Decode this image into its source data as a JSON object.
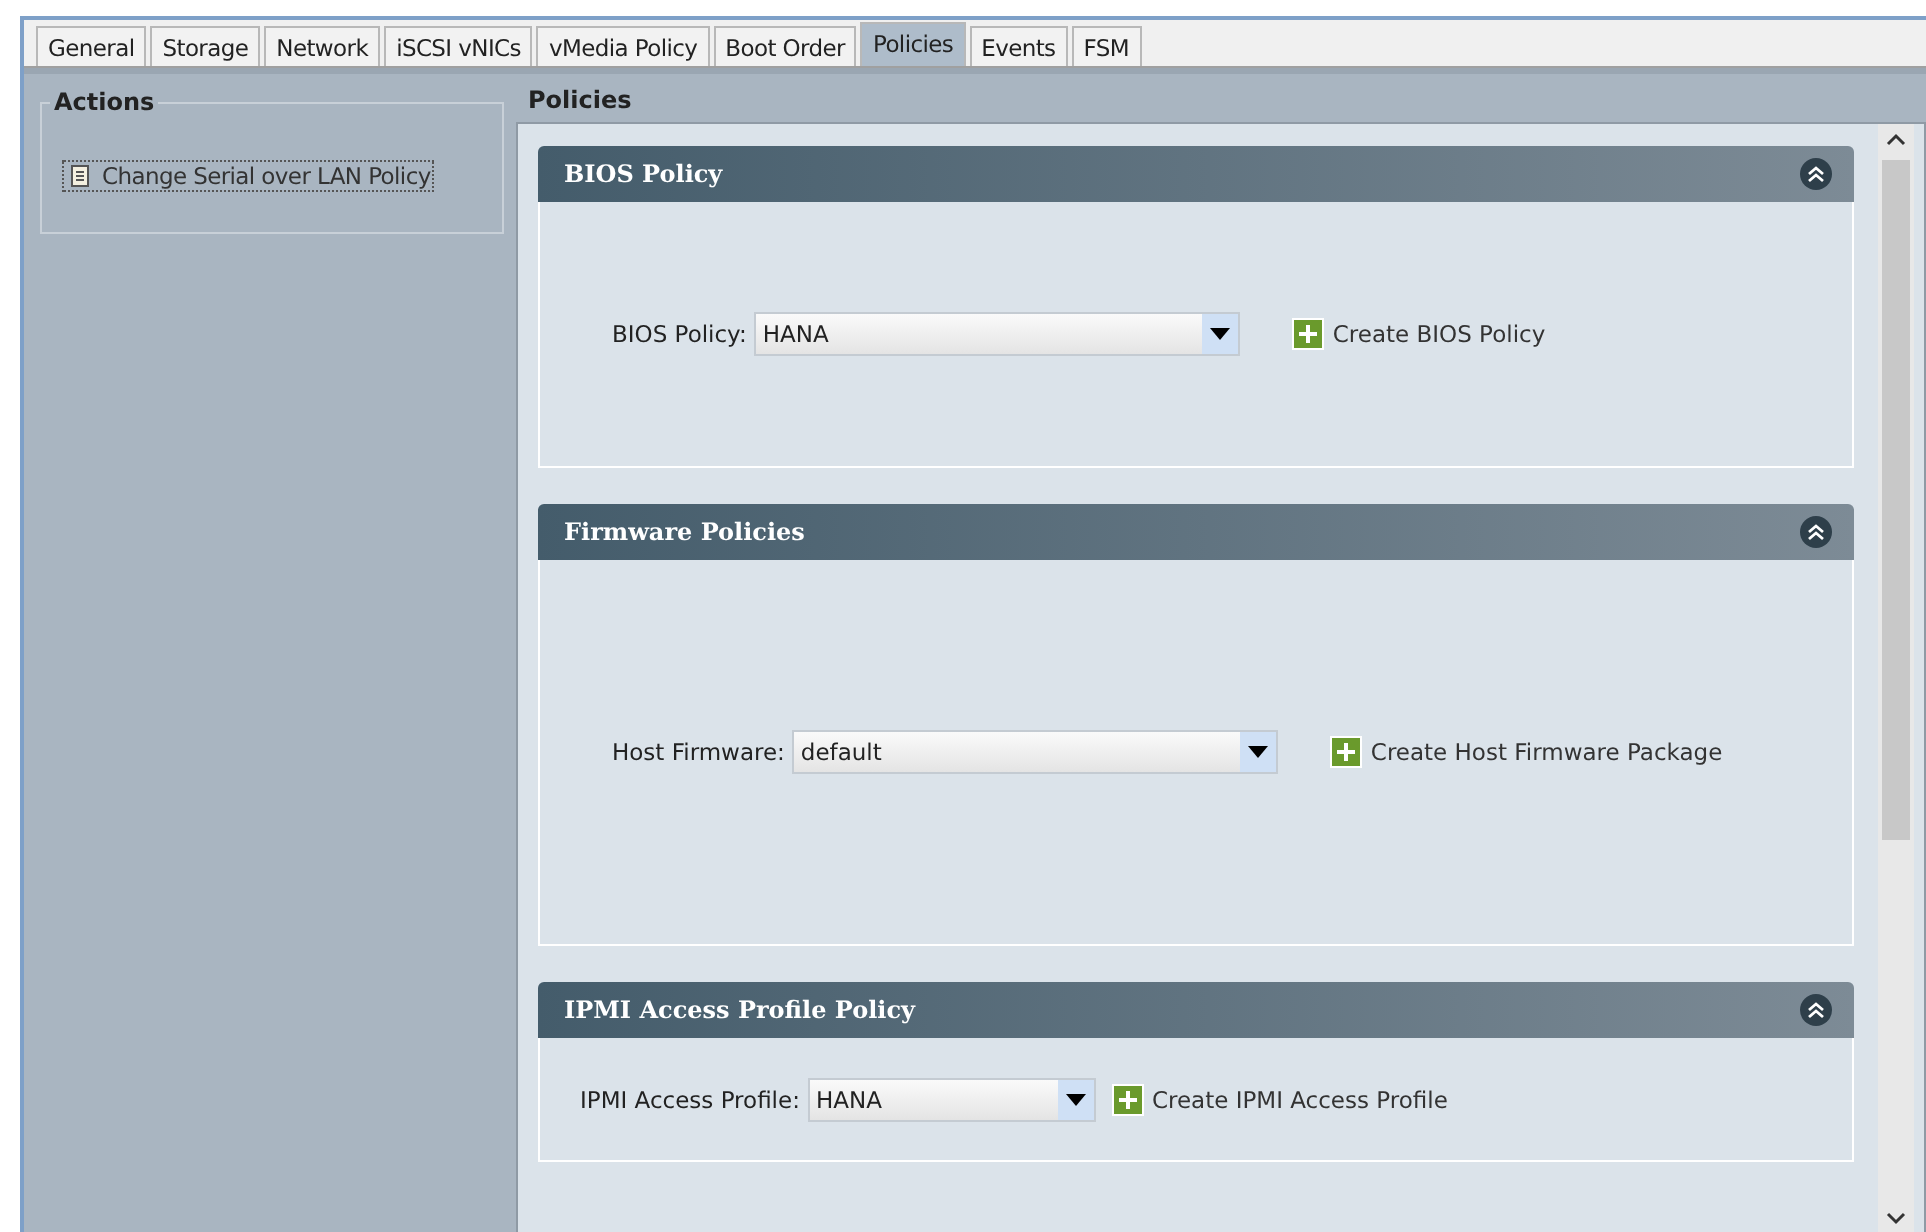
{
  "tabs": [
    {
      "label": "General",
      "selected": false
    },
    {
      "label": "Storage",
      "selected": false
    },
    {
      "label": "Network",
      "selected": false
    },
    {
      "label": "iSCSI vNICs",
      "selected": false
    },
    {
      "label": "vMedia Policy",
      "selected": false
    },
    {
      "label": "Boot Order",
      "selected": false
    },
    {
      "label": "Policies",
      "selected": true
    },
    {
      "label": "Events",
      "selected": false
    },
    {
      "label": "FSM",
      "selected": false
    }
  ],
  "actions": {
    "title": "Actions",
    "items": [
      "Change Serial over LAN Policy"
    ]
  },
  "policies": {
    "title": "Policies",
    "sections": [
      {
        "title": "BIOS Policy",
        "expanded": true,
        "field_label": "BIOS Policy:",
        "value": "HANA",
        "create_link": "Create BIOS Policy"
      },
      {
        "title": "Firmware Policies",
        "expanded": true,
        "field_label": "Host Firmware:",
        "value": "default",
        "create_link": "Create Host Firmware Package"
      },
      {
        "title": "IPMI Access Profile Policy",
        "expanded": true,
        "field_label": "IPMI Access Profile:",
        "value": "HANA",
        "create_link": "Create IPMI Access Profile"
      }
    ]
  }
}
